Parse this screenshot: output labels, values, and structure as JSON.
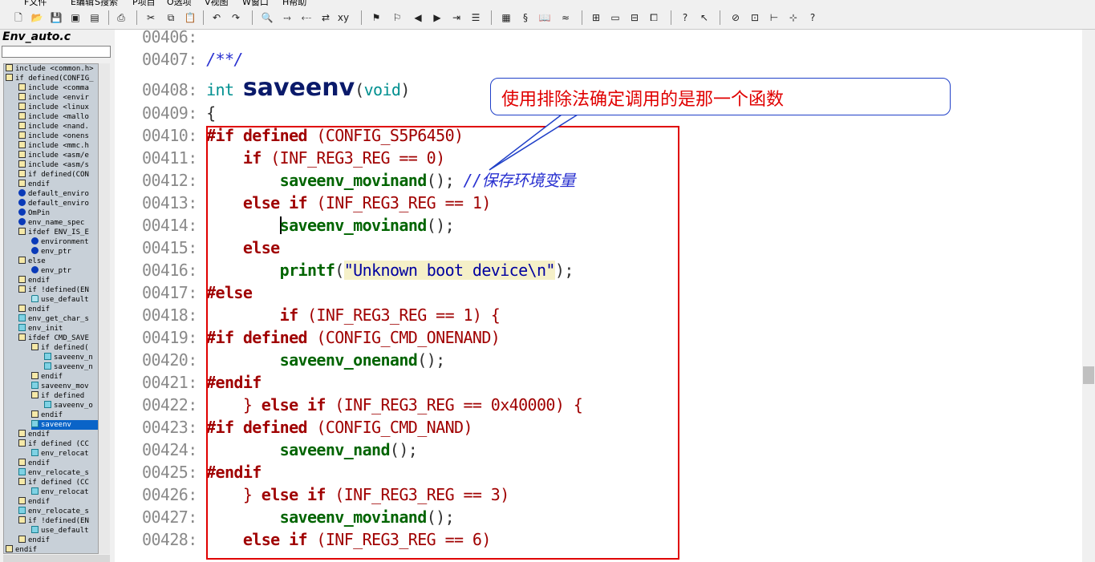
{
  "menu": {
    "items": [
      "F文件",
      "E编辑",
      "S搜索",
      "P项目",
      "O选项",
      "V视图",
      "W窗口",
      "H帮助"
    ]
  },
  "toolbar": {
    "icons": [
      "new-file-icon",
      "open-folder-icon",
      "save-icon",
      "save-as-icon",
      "save-all-icon",
      "print-icon",
      "cut-icon",
      "copy-icon",
      "paste-icon",
      "undo-icon",
      "redo-icon",
      "find-icon",
      "find-next-icon",
      "find-prev-icon",
      "replace-icon",
      "xy-icon",
      "bookmark-icon",
      "bookmark-next-icon",
      "back-icon",
      "forward-icon",
      "jump-icon",
      "indent-icon",
      "project-icon",
      "symbol-icon",
      "book-icon",
      "wave-icon",
      "window-1-icon",
      "window-2-icon",
      "window-3-icon",
      "window-4-icon",
      "help-context-icon",
      "pointer-help-icon",
      "link-icon",
      "graph-icon",
      "tree-icon",
      "relation-icon",
      "help-icon"
    ]
  },
  "sidebar": {
    "title": "Env_auto.c",
    "search_value": "",
    "tree": [
      {
        "label": "include <common.h>",
        "icon": "hash",
        "depth": 0
      },
      {
        "label": "if defined(CONFIG_",
        "icon": "hash",
        "depth": 0
      },
      {
        "label": "include <comma",
        "icon": "hash",
        "depth": 1
      },
      {
        "label": "include <envir",
        "icon": "hash",
        "depth": 1
      },
      {
        "label": "include <linux",
        "icon": "hash",
        "depth": 1
      },
      {
        "label": "include <mallo",
        "icon": "hash",
        "depth": 1
      },
      {
        "label": "include <nand.",
        "icon": "hash",
        "depth": 1
      },
      {
        "label": "include <onens",
        "icon": "hash",
        "depth": 1
      },
      {
        "label": "include <mmc.h",
        "icon": "hash",
        "depth": 1
      },
      {
        "label": "include <asm/e",
        "icon": "hash",
        "depth": 1
      },
      {
        "label": "include <asm/s",
        "icon": "hash",
        "depth": 1
      },
      {
        "label": "if defined(CON",
        "icon": "hash",
        "depth": 1
      },
      {
        "label": "endif",
        "icon": "hash",
        "depth": 1
      },
      {
        "label": "default_enviro",
        "icon": "var",
        "depth": 1
      },
      {
        "label": "default_enviro",
        "icon": "var",
        "depth": 1
      },
      {
        "label": "OmPin",
        "icon": "var",
        "depth": 1
      },
      {
        "label": "env_name_spec",
        "icon": "var",
        "depth": 1
      },
      {
        "label": "ifdef ENV_IS_E",
        "icon": "hash",
        "depth": 1
      },
      {
        "label": "environment",
        "icon": "var",
        "depth": 2
      },
      {
        "label": "env_ptr",
        "icon": "var",
        "depth": 2
      },
      {
        "label": "else",
        "icon": "hash",
        "depth": 1
      },
      {
        "label": "env_ptr",
        "icon": "var",
        "depth": 2
      },
      {
        "label": "endif",
        "icon": "hash",
        "depth": 1
      },
      {
        "label": "if !defined(EN",
        "icon": "hash",
        "depth": 1
      },
      {
        "label": "use_default",
        "icon": "typ",
        "depth": 2
      },
      {
        "label": "endif",
        "icon": "hash",
        "depth": 1
      },
      {
        "label": "env_get_char_s",
        "icon": "fn",
        "depth": 1
      },
      {
        "label": "env_init",
        "icon": "fn",
        "depth": 1
      },
      {
        "label": "ifdef CMD_SAVE",
        "icon": "hash",
        "depth": 1
      },
      {
        "label": "if defined(",
        "icon": "hash",
        "depth": 2
      },
      {
        "label": "saveenv_n",
        "icon": "fn",
        "depth": 3
      },
      {
        "label": "saveenv_n",
        "icon": "fn",
        "depth": 3
      },
      {
        "label": "endif",
        "icon": "hash",
        "depth": 2
      },
      {
        "label": "saveenv_mov",
        "icon": "fn",
        "depth": 2
      },
      {
        "label": "if defined",
        "icon": "hash",
        "depth": 2
      },
      {
        "label": "saveenv_o",
        "icon": "fn",
        "depth": 3
      },
      {
        "label": "endif",
        "icon": "hash",
        "depth": 2
      },
      {
        "label": "saveenv",
        "icon": "fn",
        "depth": 2,
        "selected": true
      },
      {
        "label": "endif",
        "icon": "hash",
        "depth": 1
      },
      {
        "label": "if defined (CC",
        "icon": "hash",
        "depth": 1
      },
      {
        "label": "env_relocat",
        "icon": "fn",
        "depth": 2
      },
      {
        "label": "endif",
        "icon": "hash",
        "depth": 1
      },
      {
        "label": "env_relocate_s",
        "icon": "fn",
        "depth": 1
      },
      {
        "label": "if defined (CC",
        "icon": "hash",
        "depth": 1
      },
      {
        "label": "env_relocat",
        "icon": "fn",
        "depth": 2
      },
      {
        "label": "endif",
        "icon": "hash",
        "depth": 1
      },
      {
        "label": "env_relocate_s",
        "icon": "fn",
        "depth": 1
      },
      {
        "label": "if !defined(EN",
        "icon": "hash",
        "depth": 1
      },
      {
        "label": "use_default",
        "icon": "fn",
        "depth": 2
      },
      {
        "label": "endif",
        "icon": "hash",
        "depth": 1
      },
      {
        "label": "endif",
        "icon": "hash",
        "depth": 0
      }
    ]
  },
  "code": {
    "lines": [
      {
        "num": "00406:",
        "tokens": []
      },
      {
        "num": "00407:",
        "tokens": [
          {
            "t": " /**/",
            "c": "cmt"
          }
        ]
      },
      {
        "num": "00408:",
        "tokens": [
          {
            "t": " int ",
            "c": "kw"
          },
          {
            "t": "saveenv",
            "c": "big"
          },
          {
            "t": "(",
            "c": "pun"
          },
          {
            "t": "void",
            "c": "kw"
          },
          {
            "t": ")",
            "c": "pun"
          }
        ]
      },
      {
        "num": "00409:",
        "tokens": [
          {
            "t": " {",
            "c": "pun"
          }
        ]
      },
      {
        "num": "00410:",
        "tokens": [
          {
            "t": " #if defined ",
            "c": "pp"
          },
          {
            "t": "(CONFIG_S5P6450)",
            "c": "mac"
          }
        ]
      },
      {
        "num": "00411:",
        "tokens": [
          {
            "t": "     if ",
            "c": "pp"
          },
          {
            "t": "(INF_REG3_REG == 0)",
            "c": "mac"
          }
        ]
      },
      {
        "num": "00412:",
        "tokens": [
          {
            "t": "         saveenv_movinand",
            "c": "fnc"
          },
          {
            "t": "(); ",
            "c": "pun"
          },
          {
            "t": "//保存环境变量",
            "c": "cmt"
          }
        ]
      },
      {
        "num": "00413:",
        "tokens": [
          {
            "t": "     else if ",
            "c": "pp"
          },
          {
            "t": "(INF_REG3_REG == 1)",
            "c": "mac"
          }
        ]
      },
      {
        "num": "00414:",
        "tokens": [
          {
            "t": "         ",
            "c": "pun"
          },
          {
            "t": "",
            "c": "cursor"
          },
          {
            "t": "saveenv_movinand",
            "c": "fnc"
          },
          {
            "t": "();",
            "c": "pun"
          }
        ]
      },
      {
        "num": "00415:",
        "tokens": [
          {
            "t": "     else",
            "c": "pp"
          }
        ]
      },
      {
        "num": "00416:",
        "tokens": [
          {
            "t": "         printf",
            "c": "fnc"
          },
          {
            "t": "(",
            "c": "pun"
          },
          {
            "t": "\"Unknown boot device\\n\"",
            "c": "str"
          },
          {
            "t": ");",
            "c": "pun"
          }
        ]
      },
      {
        "num": "00417:",
        "tokens": [
          {
            "t": " #else",
            "c": "pp"
          }
        ]
      },
      {
        "num": "00418:",
        "tokens": [
          {
            "t": "         if ",
            "c": "pp"
          },
          {
            "t": "(INF_REG3_REG == 1) {",
            "c": "mac"
          }
        ]
      },
      {
        "num": "00419:",
        "tokens": [
          {
            "t": " #if defined ",
            "c": "pp"
          },
          {
            "t": "(CONFIG_CMD_ONENAND)",
            "c": "mac"
          }
        ]
      },
      {
        "num": "00420:",
        "tokens": [
          {
            "t": "         saveenv_onenand",
            "c": "fnc"
          },
          {
            "t": "();",
            "c": "pun"
          }
        ]
      },
      {
        "num": "00421:",
        "tokens": [
          {
            "t": " #endif",
            "c": "pp"
          }
        ]
      },
      {
        "num": "00422:",
        "tokens": [
          {
            "t": "     } ",
            "c": "mac"
          },
          {
            "t": "else if ",
            "c": "pp"
          },
          {
            "t": "(INF_REG3_REG == 0x40000) {",
            "c": "mac"
          }
        ]
      },
      {
        "num": "00423:",
        "tokens": [
          {
            "t": " #if defined ",
            "c": "pp"
          },
          {
            "t": "(CONFIG_CMD_NAND)",
            "c": "mac"
          }
        ]
      },
      {
        "num": "00424:",
        "tokens": [
          {
            "t": "         saveenv_nand",
            "c": "fnc"
          },
          {
            "t": "();",
            "c": "pun"
          }
        ]
      },
      {
        "num": "00425:",
        "tokens": [
          {
            "t": " #endif",
            "c": "pp"
          }
        ]
      },
      {
        "num": "00426:",
        "tokens": [
          {
            "t": "     } ",
            "c": "mac"
          },
          {
            "t": "else if ",
            "c": "pp"
          },
          {
            "t": "(INF_REG3_REG == 3)",
            "c": "mac"
          }
        ]
      },
      {
        "num": "00427:",
        "tokens": [
          {
            "t": "         saveenv_movinand",
            "c": "fnc"
          },
          {
            "t": "();",
            "c": "pun"
          }
        ]
      },
      {
        "num": "00428:",
        "tokens": [
          {
            "t": "     else if ",
            "c": "pp"
          },
          {
            "t": "(INF_REG3_REG == 6)",
            "c": "mac"
          }
        ]
      }
    ]
  },
  "annotation": {
    "text": "使用排除法确定调用的是那一个函数",
    "color": "#e00000",
    "border_color": "#2040c8",
    "box_color": "#e00000"
  }
}
